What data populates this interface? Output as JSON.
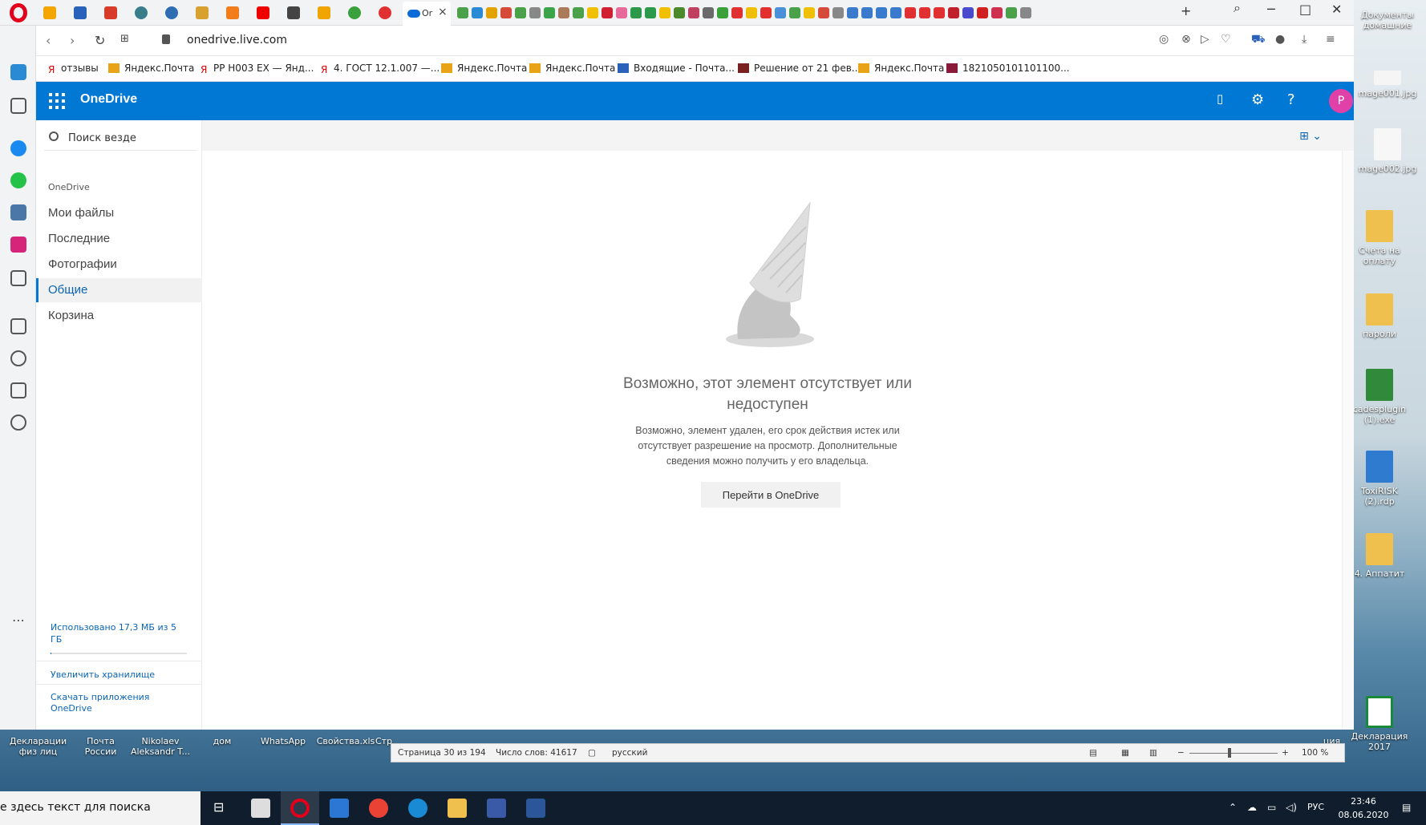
{
  "browser": {
    "active_tab_title": "Or",
    "url": "onedrive.live.com",
    "bookmarks": [
      "отзывы",
      "Яндекс.Почта",
      "РР Н003 ЕХ — Янд...",
      "4. ГОСТ 12.1.007 —...",
      "Яндекс.Почта",
      "Яндекс.Почта",
      "Входящие - Почта...",
      "Решение от 21 фев...",
      "Яндекс.Почта",
      "1821050101101100..."
    ]
  },
  "onedrive": {
    "brand": "OneDrive",
    "avatar_letter": "P",
    "search_placeholder": "Поиск везде",
    "section_label": "OneDrive",
    "nav": [
      "Мои файлы",
      "Последние",
      "Фотографии",
      "Общие",
      "Корзина"
    ],
    "active_nav": "Общие",
    "quota_text": "Использовано 17,3 МБ из 5 ГБ",
    "quota_fraction": 0.0035,
    "upgrade_link": "Увеличить хранилище",
    "apps_link": "Скачать приложения OneDrive",
    "empty": {
      "title": "Возможно, этот элемент отсутствует или недоступен",
      "description": "Возможно, элемент удален, его срок действия истек или отсутствует разрешение на просмотр. Дополнительные сведения можно получить у его владельца.",
      "button": "Перейти в OneDrive"
    }
  },
  "desktop_icons": [
    "Документы домашние",
    "mage001.jpg",
    "mage002.jpg",
    "Счета на оплату",
    "пароли",
    "cadesplugin (1).exe",
    "ToxiRISK (2).rdp",
    "4. Аппатит",
    "Декларация 2017"
  ],
  "behind_labels": [
    "Декларации физ лиц",
    "Почта России",
    "Nikolaev Aleksandr T...",
    "дом",
    "WhatsApp",
    "Свойства.xls",
    "Стр",
    "ция"
  ],
  "word_status": {
    "page": "Страница 30 из 194",
    "words": "Число слов: 41617",
    "language": "русский",
    "zoom": "100 %"
  },
  "taskbar": {
    "search_placeholder": "е здесь текст для поиска",
    "lang": "РУС",
    "time": "23:46",
    "date": "08.06.2020"
  }
}
